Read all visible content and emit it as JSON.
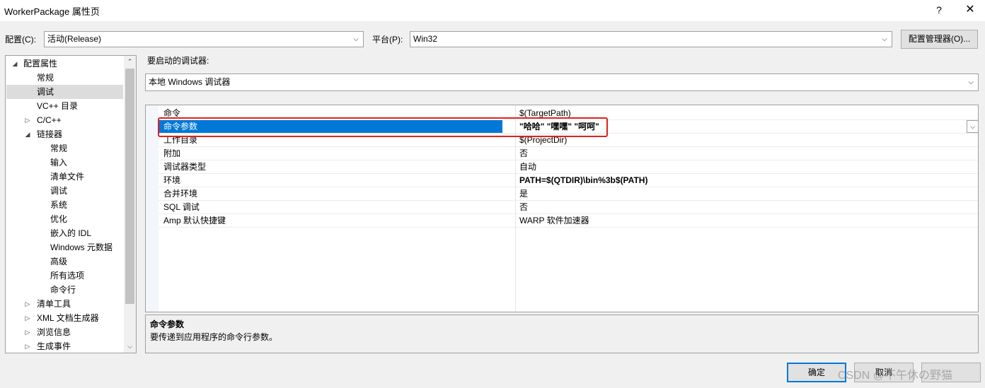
{
  "window": {
    "title": "WorkerPackage 属性页",
    "help_glyph": "?",
    "close_glyph": "✕"
  },
  "toolbar": {
    "config_label": "配置(C):",
    "config_value": "活动(Release)",
    "platform_label": "平台(P):",
    "platform_value": "Win32",
    "config_manager_label": "配置管理器(O)..."
  },
  "tree": {
    "items": [
      {
        "label": "配置属性",
        "glyph": "◢"
      },
      {
        "label": "常规",
        "glyph": ""
      },
      {
        "label": "调试",
        "glyph": ""
      },
      {
        "label": "VC++ 目录",
        "glyph": ""
      },
      {
        "label": "C/C++",
        "glyph": "▷"
      },
      {
        "label": "链接器",
        "glyph": "◢"
      },
      {
        "label": "常规",
        "glyph": ""
      },
      {
        "label": "输入",
        "glyph": ""
      },
      {
        "label": "清单文件",
        "glyph": ""
      },
      {
        "label": "调试",
        "glyph": ""
      },
      {
        "label": "系统",
        "glyph": ""
      },
      {
        "label": "优化",
        "glyph": ""
      },
      {
        "label": "嵌入的 IDL",
        "glyph": ""
      },
      {
        "label": "Windows 元数据",
        "glyph": ""
      },
      {
        "label": "高级",
        "glyph": ""
      },
      {
        "label": "所有选项",
        "glyph": ""
      },
      {
        "label": "命令行",
        "glyph": ""
      },
      {
        "label": "清单工具",
        "glyph": "▷"
      },
      {
        "label": "XML 文档生成器",
        "glyph": "▷"
      },
      {
        "label": "浏览信息",
        "glyph": "▷"
      },
      {
        "label": "生成事件",
        "glyph": "▷"
      }
    ]
  },
  "debugger": {
    "label": "要启动的调试器:",
    "value": "本地 Windows 调试器"
  },
  "properties": {
    "rows": [
      {
        "name": "命令",
        "value": "$(TargetPath)"
      },
      {
        "name": "命令参数",
        "value": "\"哈哈\" \"嘿嘿\" \"呵呵\""
      },
      {
        "name": "工作目录",
        "value": "$(ProjectDir)"
      },
      {
        "name": "附加",
        "value": "否"
      },
      {
        "name": "调试器类型",
        "value": "自动"
      },
      {
        "name": "环境",
        "value": "PATH=$(QTDIR)\\bin%3b$(PATH)"
      },
      {
        "name": "合并环境",
        "value": "是"
      },
      {
        "name": "SQL 调试",
        "value": "否"
      },
      {
        "name": "Amp 默认快捷键",
        "value": "WARP 软件加速器"
      }
    ]
  },
  "description": {
    "title": "命令参数",
    "text": "要传递到应用程序的命令行参数。"
  },
  "buttons": {
    "ok_label": "确定",
    "cancel_label": "取消"
  },
  "watermark": "CSDN @不午休の野猫",
  "colors": {
    "selection": "#0078d7",
    "highlight_box": "#e0201c"
  }
}
